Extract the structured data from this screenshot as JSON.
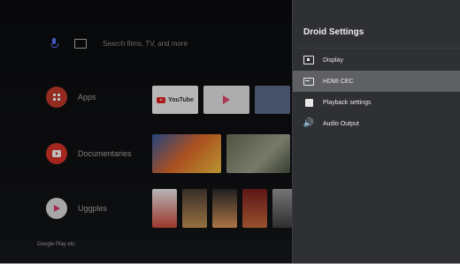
{
  "launcher": {
    "search_placeholder": "Search films, TV, and more",
    "rows": [
      {
        "label": "Apps"
      },
      {
        "label": "Documentaries"
      },
      {
        "label": "Uggples"
      }
    ],
    "bottom_text": "Google Play etc."
  },
  "settings_panel": {
    "title": "Droid Settings",
    "items": [
      {
        "label": "Display",
        "icon": "display-icon"
      },
      {
        "label": "HDMI CEC",
        "icon": "hdmi-icon",
        "selected": true
      },
      {
        "label": "Playback settings",
        "icon": "playback-icon"
      },
      {
        "label": "Audio Output",
        "icon": "speaker-icon"
      }
    ]
  },
  "tiles": {
    "youtube_label": "YouTube",
    "play_label": "Google Play"
  }
}
